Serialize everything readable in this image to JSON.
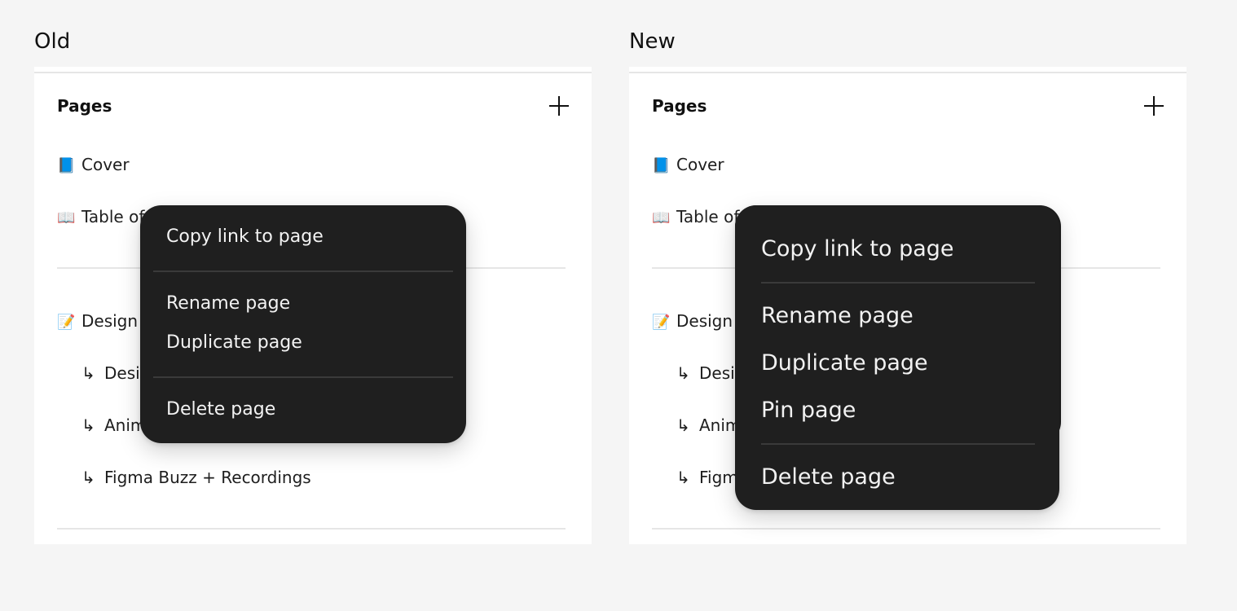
{
  "columns": {
    "old_label": "Old",
    "new_label": "New"
  },
  "panel": {
    "title": "Pages",
    "add_icon": "plus-icon",
    "rows": [
      {
        "emoji": "📘",
        "label": "Cover"
      },
      {
        "emoji": "📖",
        "label": "Table of"
      },
      {
        "emoji": "📝",
        "label": "Design"
      },
      {
        "arrow": "↳",
        "label": "Desi"
      },
      {
        "arrow": "↳",
        "label": "Anim"
      },
      {
        "arrow": "↳",
        "label": "Figma Buzz + Recordings"
      },
      {
        "arrow": "↳",
        "label": "Figm"
      }
    ]
  },
  "old_menu": {
    "copy_link": "Copy link to page",
    "rename": "Rename page",
    "duplicate": "Duplicate page",
    "delete": "Delete page"
  },
  "new_menu": {
    "copy_link": "Copy link to page",
    "rename": "Rename page",
    "duplicate": "Duplicate page",
    "pin": "Pin page",
    "delete": "Delete page"
  },
  "colors": {
    "menu_bg": "#1f1f1f",
    "menu_text": "#f2f2f2",
    "page_bg": "#f5f5f5",
    "panel_bg": "#ffffff"
  }
}
